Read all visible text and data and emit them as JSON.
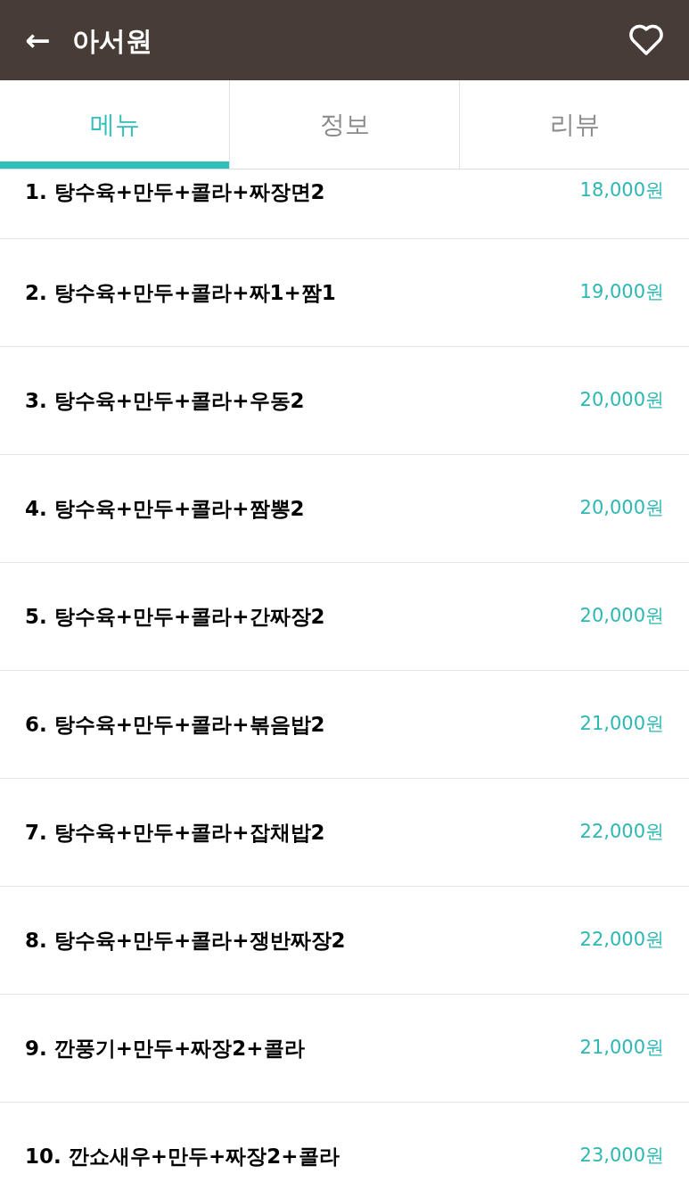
{
  "header": {
    "back": "←",
    "title": "아서원"
  },
  "tabs": [
    {
      "label": "메뉴",
      "selected": true
    },
    {
      "label": "정보",
      "selected": false
    },
    {
      "label": "리뷰",
      "selected": false
    }
  ],
  "menu_items": [
    {
      "name": "1. 탕수육+만두+콜라+짜장면2",
      "price": "18,000원"
    },
    {
      "name": "2. 탕수육+만두+콜라+짜1+짬1",
      "price": "19,000원"
    },
    {
      "name": "3. 탕수육+만두+콜라+우동2",
      "price": "20,000원"
    },
    {
      "name": "4. 탕수육+만두+콜라+짬뽕2",
      "price": "20,000원"
    },
    {
      "name": "5. 탕수육+만두+콜라+간짜장2",
      "price": "20,000원"
    },
    {
      "name": "6. 탕수육+만두+콜라+볶음밥2",
      "price": "21,000원"
    },
    {
      "name": "7. 탕수육+만두+콜라+잡채밥2",
      "price": "22,000원"
    },
    {
      "name": "8. 탕수육+만두+콜라+쟁반짜장2",
      "price": "22,000원"
    },
    {
      "name": "9. 깐풍기+만두+짜장2+콜라",
      "price": "21,000원"
    },
    {
      "name": "10. 깐쇼새우+만두+짜장2+콜라",
      "price": "23,000원"
    }
  ]
}
